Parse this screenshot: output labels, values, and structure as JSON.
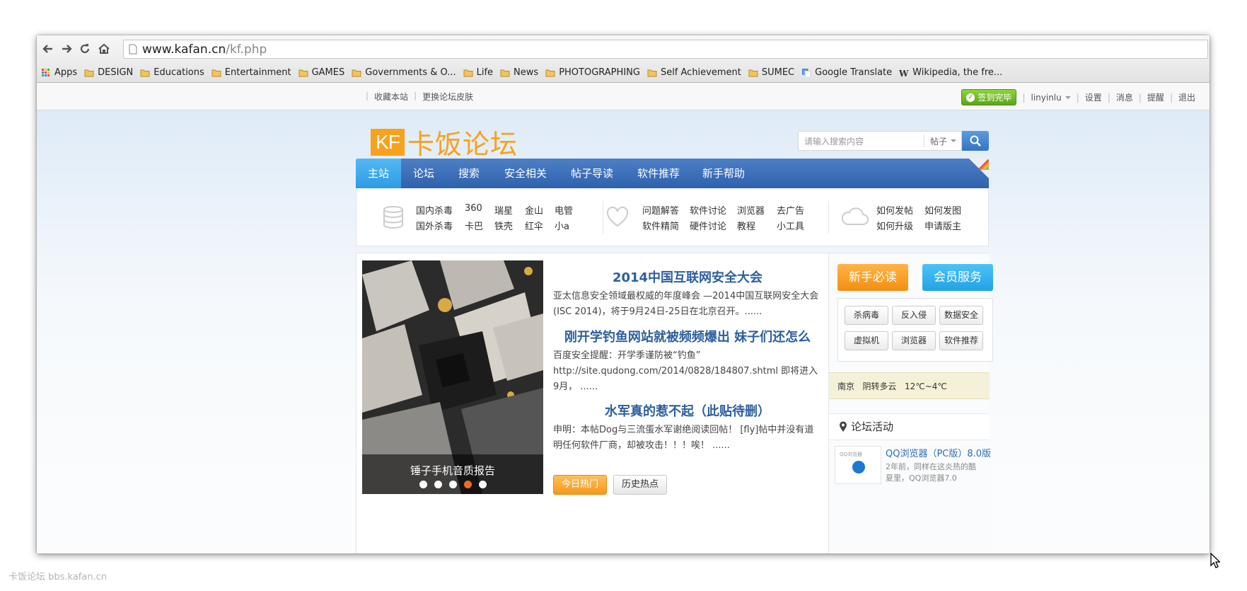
{
  "browser": {
    "url_host": "www.kafan.cn",
    "url_path": "/kf.php",
    "bookmarks": [
      {
        "label": "Apps",
        "icon": "apps-grid-icon"
      },
      {
        "label": "DESIGN",
        "icon": "folder-icon"
      },
      {
        "label": "Educations",
        "icon": "folder-icon"
      },
      {
        "label": "Entertainment",
        "icon": "folder-icon"
      },
      {
        "label": "GAMES",
        "icon": "folder-icon"
      },
      {
        "label": "Governments & O...",
        "icon": "folder-icon"
      },
      {
        "label": "Life",
        "icon": "folder-icon"
      },
      {
        "label": "News",
        "icon": "folder-icon"
      },
      {
        "label": "PHOTOGRAPHING",
        "icon": "folder-icon"
      },
      {
        "label": "Self Achievement",
        "icon": "folder-icon"
      },
      {
        "label": "SUMEC",
        "icon": "folder-icon"
      },
      {
        "label": "Google Translate",
        "icon": "google-translate-icon"
      },
      {
        "label": "Wikipedia, the fre...",
        "icon": "wikipedia-icon"
      }
    ]
  },
  "topbar": {
    "left_links": [
      "收藏本站",
      "更换论坛皮肤"
    ],
    "signin_badge": "签到完毕",
    "username": "linyinlu",
    "right_links": [
      "设置",
      "消息",
      "提醒",
      "退出"
    ]
  },
  "logo": {
    "mark": "KF",
    "name": "卡饭论坛"
  },
  "search": {
    "placeholder": "请输入搜索内容",
    "scope": "帖子"
  },
  "mainnav": {
    "items": [
      "主站",
      "论坛",
      "搜索",
      "安全相关",
      "帖子导读",
      "软件推荐",
      "新手帮助"
    ],
    "active_index": 0
  },
  "subnav": {
    "group1": [
      [
        "国内杀毒",
        "360",
        "瑞星",
        "金山",
        "电管"
      ],
      [
        "国外杀毒",
        "卡巴",
        "铁壳",
        "红伞",
        "小a"
      ]
    ],
    "group2": [
      [
        "问题解答",
        "软件讨论",
        "浏览器",
        "去广告"
      ],
      [
        "软件精简",
        "硬件讨论",
        "教程",
        "小工具"
      ]
    ],
    "group3": [
      [
        "如何发帖",
        "如何发图"
      ],
      [
        "如何升级",
        "申请版主"
      ]
    ]
  },
  "slideshow": {
    "caption": "锤子手机音质报告",
    "dot_count": 5,
    "active_dot": 3
  },
  "news": [
    {
      "title": "2014中国互联网安全大会",
      "body": "亚太信息安全领域最权威的年度峰会 —2014中国互联网安全大会(ISC 2014)，将于9月24日-25日在北京召开。......"
    },
    {
      "title": "刚开学钓鱼网站就被频频爆出 妹子们还怎么",
      "body": "百度安全提醒：开学季谨防被“钓鱼” http://site.qudong.com/2014/0828/184807.shtml 即将进入9月，  ......"
    },
    {
      "title": "水军真的惹不起（此贴待删）",
      "body": "申明：本帖Dog与三流蛋水军谢绝阅读回帖！ [fly]帖中并没有道明任何软件厂商，却被攻击！！！唉！ ......"
    }
  ],
  "news_tabs": {
    "hot": "今日热门",
    "history": "历史热点"
  },
  "sidebar": {
    "btn_newbie": "新手必读",
    "btn_member": "会员服务",
    "tags": [
      "杀病毒",
      "反入侵",
      "数据安全",
      "虚拟机",
      "浏览器",
      "软件推荐"
    ],
    "weather_city": "南京",
    "weather_desc": "阴转多云",
    "weather_temp": "12℃~4℃",
    "activity_title": "论坛活动",
    "activity_item_title": "QQ浏览器（PC版）8.0版",
    "activity_item_desc": "2年前，同样在这炎热的酷夏里，QQ浏览器7.0",
    "activity_thumb_text": "QQ浏览器"
  },
  "watermark": "卡饭论坛 bbs.kafan.cn",
  "colors": {
    "nav_blue": "#2f62ae",
    "nav_active": "#2d9be6",
    "brand_orange": "#f7a21c",
    "link_blue": "#2c5f9e"
  }
}
